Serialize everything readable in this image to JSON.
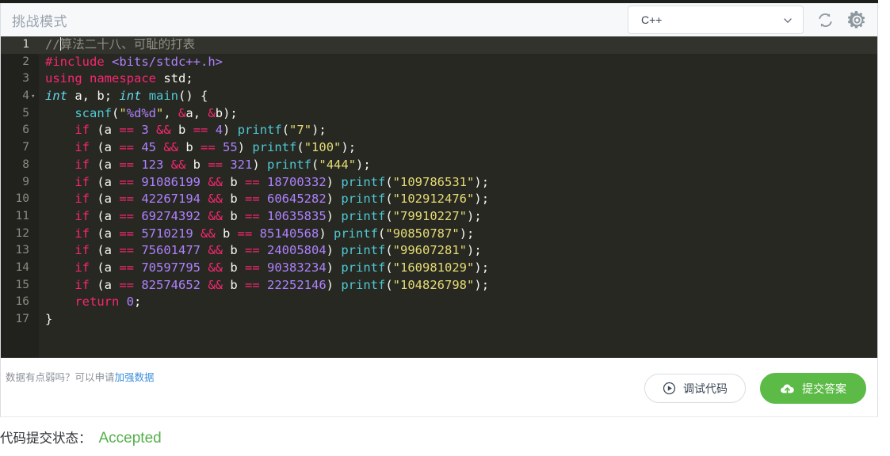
{
  "header": {
    "title": "挑战模式",
    "language_select": {
      "value": "C++",
      "options": [
        "C++"
      ],
      "caret_icon": "chevron-down-icon"
    },
    "refresh_icon": "refresh-icon",
    "settings_icon": "gear-icon"
  },
  "editor": {
    "language": "C++",
    "active_line": 1,
    "theme_bg": "#272822",
    "gutter_bg": "#21221d",
    "active_line_bg": "#32332c",
    "lines": [
      {
        "n": "1",
        "fold": false
      },
      {
        "n": "2",
        "fold": false
      },
      {
        "n": "3",
        "fold": false
      },
      {
        "n": "4",
        "fold": true
      },
      {
        "n": "5",
        "fold": false
      },
      {
        "n": "6",
        "fold": false
      },
      {
        "n": "7",
        "fold": false
      },
      {
        "n": "8",
        "fold": false
      },
      {
        "n": "9",
        "fold": false
      },
      {
        "n": "10",
        "fold": false
      },
      {
        "n": "11",
        "fold": false
      },
      {
        "n": "12",
        "fold": false
      },
      {
        "n": "13",
        "fold": false
      },
      {
        "n": "14",
        "fold": false
      },
      {
        "n": "15",
        "fold": false
      },
      {
        "n": "16",
        "fold": false
      },
      {
        "n": "17",
        "fold": false
      }
    ],
    "source_text": "//算法二十八、可耻的打表\n#include <bits/stdc++.h>\nusing namespace std;\nint a, b; int main() {\n    scanf(\"%d%d\", &a, &b);\n    if (a == 3 && b == 4) printf(\"7\");\n    if (a == 45 && b == 55) printf(\"100\");\n    if (a == 123 && b == 321) printf(\"444\");\n    if (a == 91086199 && b == 18700332) printf(\"109786531\");\n    if (a == 42267194 && b == 60645282) printf(\"102912476\");\n    if (a == 69274392 && b == 10635835) printf(\"79910227\");\n    if (a == 5710219 && b == 85140568) printf(\"90850787\");\n    if (a == 75601477 && b == 24005804) printf(\"99607281\");\n    if (a == 70597795 && b == 90383234) printf(\"160981029\");\n    if (a == 82574652 && b == 22252146) printf(\"104826798\");\n    return 0;\n}",
    "comment_text": "//算法二十八、可耻的打表",
    "table_entries": [
      {
        "a": "3",
        "b": "4",
        "out": "7"
      },
      {
        "a": "45",
        "b": "55",
        "out": "100"
      },
      {
        "a": "123",
        "b": "321",
        "out": "444"
      },
      {
        "a": "91086199",
        "b": "18700332",
        "out": "109786531"
      },
      {
        "a": "42267194",
        "b": "60645282",
        "out": "102912476"
      },
      {
        "a": "69274392",
        "b": "10635835",
        "out": "79910227"
      },
      {
        "a": "5710219",
        "b": "85140568",
        "out": "90850787"
      },
      {
        "a": "75601477",
        "b": "24005804",
        "out": "99607281"
      },
      {
        "a": "70597795",
        "b": "90383234",
        "out": "160981029"
      },
      {
        "a": "82574652",
        "b": "22252146",
        "out": "104826798"
      }
    ]
  },
  "actions": {
    "hint_prefix": "数据有点弱吗？可以申请",
    "hint_link": "加强数据",
    "debug_button": {
      "label": "调试代码",
      "icon": "play-circle-icon"
    },
    "submit_button": {
      "label": "提交答案",
      "icon": "cloud-upload-icon",
      "color": "#5cba47"
    }
  },
  "status": {
    "label": "代码提交状态：",
    "value": "Accepted",
    "value_color": "#53b04a"
  }
}
